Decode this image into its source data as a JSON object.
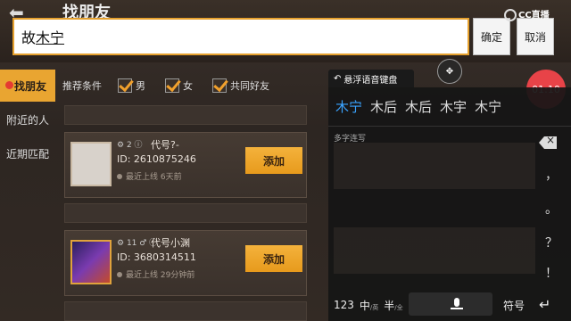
{
  "header": {
    "title": "找朋友",
    "back_icon": "back-arrow-icon"
  },
  "sidebar": {
    "items": [
      {
        "label": "找朋友",
        "active": true,
        "badge": true
      },
      {
        "label": "附近的人",
        "active": false
      },
      {
        "label": "近期匹配",
        "active": false
      }
    ]
  },
  "filters": {
    "label": "推荐条件",
    "options": [
      {
        "label": "男",
        "checked": true
      },
      {
        "label": "女",
        "checked": true
      },
      {
        "label": "共同好友",
        "checked": true
      }
    ]
  },
  "friends": [
    {
      "level": "2",
      "name": "代号?-",
      "id": "ID: 2610875246",
      "last_seen": "最近上线 6天前",
      "add_label": "添加"
    },
    {
      "level": "11",
      "name": "代号小渊",
      "id": "ID: 3680314511",
      "last_seen": "最近上线 29分钟前",
      "add_label": "添加"
    }
  ],
  "input": {
    "value_prefix": "故",
    "value_composing": "木宁",
    "ok_label": "确定",
    "cancel_label": "取消"
  },
  "overlay": {
    "brand": "CC直播",
    "timer": "01:10",
    "drag_icon": "move-icon"
  },
  "keyboard": {
    "tab_label": "悬浮语音键盘",
    "candidates": [
      "木宁",
      "木后",
      "木后",
      "木宇",
      "木宁"
    ],
    "mode_label": "多字连写",
    "punctuation": [
      "，",
      "。",
      "？",
      "！"
    ],
    "bottom": {
      "num": "123",
      "zh": "中",
      "zh_sub": "/英",
      "half": "半",
      "half_sub": "/全",
      "symbol": "符号"
    }
  },
  "colors": {
    "accent": "#e9a531",
    "timer": "#e84348",
    "candidate_active": "#3aa3ff"
  }
}
